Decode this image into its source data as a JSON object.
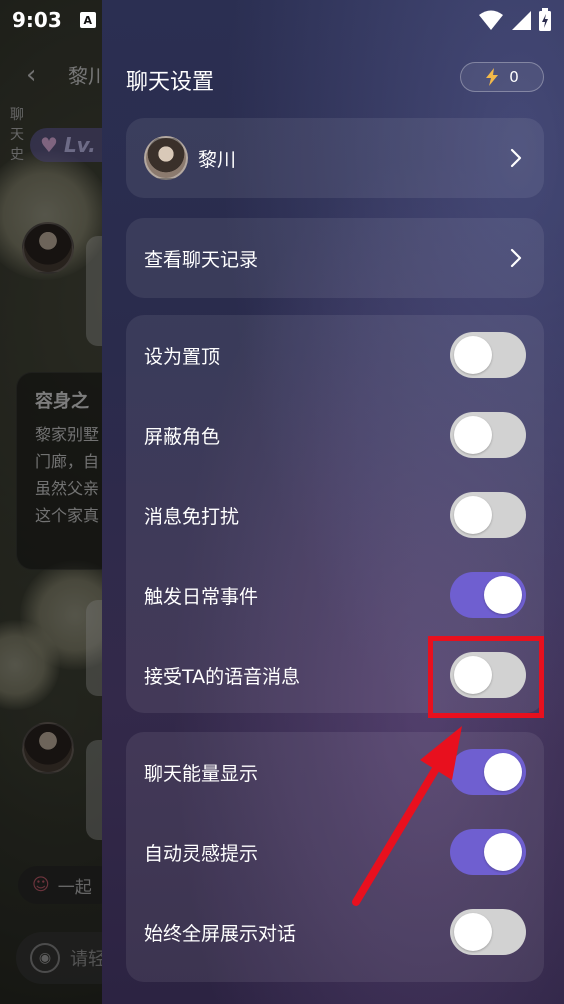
{
  "status_bar": {
    "time": "9:03",
    "a_icon": "A"
  },
  "background_chat": {
    "back_glyph": "‹",
    "contact_name": "黎川",
    "side_text": "聊天史",
    "level_badge": "Lv.",
    "card": {
      "title": "容身之",
      "lines": [
        "黎家别墅",
        "门廊，自",
        "虽然父亲",
        "这个家真"
      ]
    },
    "tag_text": "一起",
    "input_placeholder": "请轻"
  },
  "settings": {
    "title": "聊天设置",
    "energy_count": "0",
    "profile": {
      "name": "黎川"
    },
    "history_label": "查看聊天记录",
    "toggles_group1": [
      {
        "label": "设为置顶",
        "on": false
      },
      {
        "label": "屏蔽角色",
        "on": false
      },
      {
        "label": "消息免打扰",
        "on": false
      },
      {
        "label": "触发日常事件",
        "on": true
      },
      {
        "label": "接受TA的语音消息",
        "on": false
      }
    ],
    "toggles_group2": [
      {
        "label": "聊天能量显示",
        "on": true
      },
      {
        "label": "自动灵感提示",
        "on": true
      },
      {
        "label": "始终全屏展示对话",
        "on": false
      }
    ]
  },
  "colors": {
    "toggle_on": "#6f5fd0",
    "toggle_off": "#d2d2d2",
    "annotation": "#e8101e"
  }
}
